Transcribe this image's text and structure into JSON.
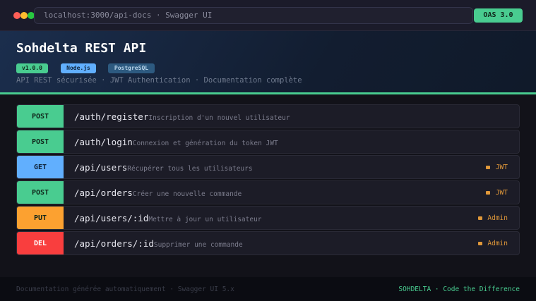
{
  "browser": {
    "url": "localhost:3000/api-docs · Swagger UI",
    "badge": "OAS 3.0"
  },
  "hero": {
    "title": "Sohdelta REST API",
    "tags": [
      "v1.0.0",
      "Node.js",
      "PostgreSQL"
    ],
    "subtitle": "API REST sécurisée · JWT Authentication · Documentation complète"
  },
  "endpoints": [
    {
      "method": "POST",
      "path": "/auth/register",
      "desc": "Inscription d'un nouvel utilisateur",
      "auth": ""
    },
    {
      "method": "POST",
      "path": "/auth/login",
      "desc": "Connexion et génération du token JWT",
      "auth": ""
    },
    {
      "method": "GET",
      "path": "/api/users",
      "desc": "Récupérer tous les utilisateurs",
      "auth": "JWT"
    },
    {
      "method": "POST",
      "path": "/api/orders",
      "desc": "Créer une nouvelle commande",
      "auth": "JWT"
    },
    {
      "method": "PUT",
      "path": "/api/users/:id",
      "desc": "Mettre à jour un utilisateur",
      "auth": "Admin"
    },
    {
      "method": "DEL",
      "path": "/api/orders/:id",
      "desc": "Supprimer une commande",
      "auth": "Admin"
    }
  ],
  "colors": {
    "POST": "#49cc90",
    "GET": "#61affe",
    "PUT": "#fca130",
    "DEL": "#f93e3e"
  },
  "footer": {
    "left": "Documentation générée automatiquement · Swagger UI 5.x",
    "right": "SOHDELTA · Code the Difference"
  }
}
